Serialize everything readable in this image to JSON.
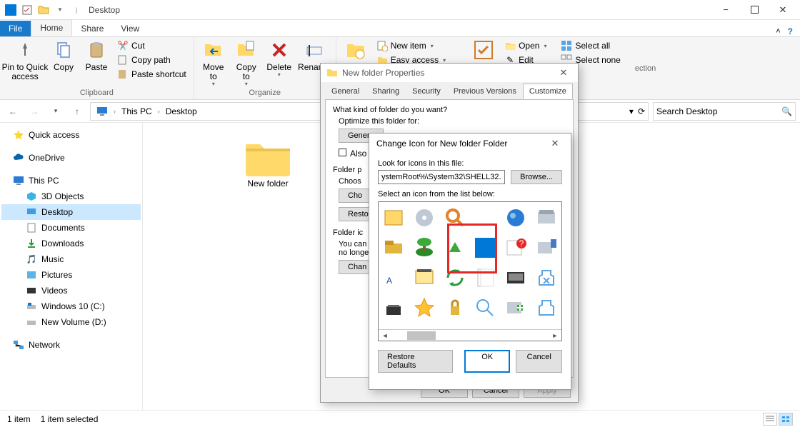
{
  "titlebar": {
    "title": "Desktop"
  },
  "ribbon_tabs": {
    "file": "File",
    "home": "Home",
    "share": "Share",
    "view": "View"
  },
  "ribbon": {
    "clipboard": {
      "pin": "Pin to Quick\naccess",
      "copy": "Copy",
      "paste": "Paste",
      "cut": "Cut",
      "copy_path": "Copy path",
      "paste_shortcut": "Paste shortcut",
      "group": "Clipboard"
    },
    "organize": {
      "moveto": "Move\nto",
      "copyto": "Copy\nto",
      "delete": "Delete",
      "rename": "Rename",
      "group": "Organize"
    },
    "new": {
      "new_item": "New item",
      "easy_access": "Easy access"
    },
    "open": {
      "open": "Open",
      "edit": "Edit"
    },
    "select": {
      "select_all": "Select all",
      "select_none": "Select none"
    }
  },
  "breadcrumb": {
    "thispc": "This PC",
    "desktop": "Desktop"
  },
  "search": {
    "placeholder": "Search Desktop"
  },
  "sidebar": {
    "quick_access": "Quick access",
    "onedrive": "OneDrive",
    "thispc": "This PC",
    "d3": "3D Objects",
    "desktop": "Desktop",
    "documents": "Documents",
    "downloads": "Downloads",
    "music": "Music",
    "pictures": "Pictures",
    "videos": "Videos",
    "cdrive": "Windows 10 (C:)",
    "ddrive": "New Volume (D:)",
    "network": "Network"
  },
  "content": {
    "folder_name": "New folder"
  },
  "statusbar": {
    "items": "1 item",
    "selected": "1 item selected"
  },
  "props": {
    "title": "New folder Properties",
    "tabs": {
      "general": "General",
      "sharing": "Sharing",
      "security": "Security",
      "previous": "Previous Versions",
      "customize": "Customize"
    },
    "q1": "What kind of folder do you want?",
    "optimize": "Optimize this folder for:",
    "general_btn": "Genera",
    "also": "Also",
    "folder_p": "Folder p",
    "choose": "Choos",
    "cho_btn": "Cho",
    "resto": "Resto",
    "folder_ic": "Folder ic",
    "you_can": "You can\nno longe",
    "change": "Chan",
    "ok": "OK",
    "cancel": "Cancel",
    "apply": "Apply"
  },
  "icondlg": {
    "title": "Change Icon for New folder Folder",
    "look": "Look for icons in this file:",
    "path": "ystemRoot%\\System32\\SHELL32.dll",
    "browse": "Browse...",
    "select": "Select an icon from the list below:",
    "restore": "Restore Defaults",
    "ok": "OK",
    "cancel": "Cancel"
  }
}
